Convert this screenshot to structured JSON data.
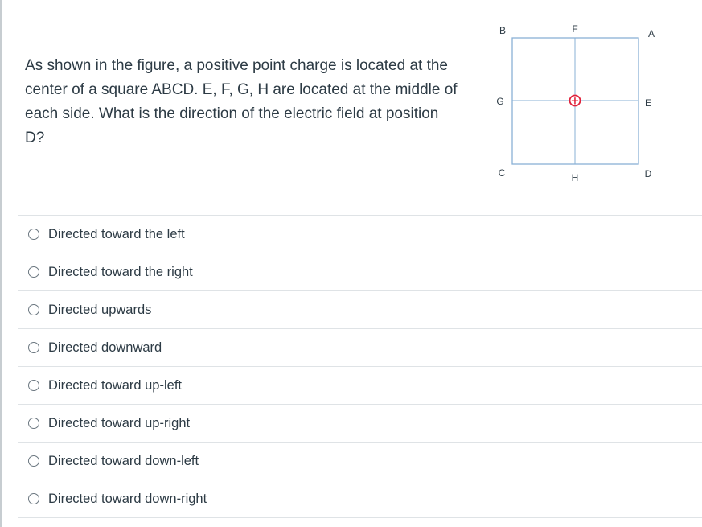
{
  "question": {
    "text": "As shown in the figure, a positive point charge is located at the center of a square ABCD. E, F, G, H are located at the middle of each side. What is the direction of the electric field at position D?"
  },
  "figure": {
    "labels": {
      "A": "A",
      "B": "B",
      "C": "C",
      "D": "D",
      "E": "E",
      "F": "F",
      "G": "G",
      "H": "H"
    },
    "charge_symbol": "+",
    "colors": {
      "square_border": "#8ab1d6",
      "charge": "#e0213a"
    }
  },
  "answers": [
    {
      "label": "Directed toward the left",
      "selected": false
    },
    {
      "label": "Directed toward the right",
      "selected": false
    },
    {
      "label": "Directed upwards",
      "selected": false
    },
    {
      "label": "Directed downward",
      "selected": false
    },
    {
      "label": "Directed toward up-left",
      "selected": false
    },
    {
      "label": "Directed toward up-right",
      "selected": false
    },
    {
      "label": "Directed toward down-left",
      "selected": false
    },
    {
      "label": "Directed toward down-right",
      "selected": false
    }
  ]
}
